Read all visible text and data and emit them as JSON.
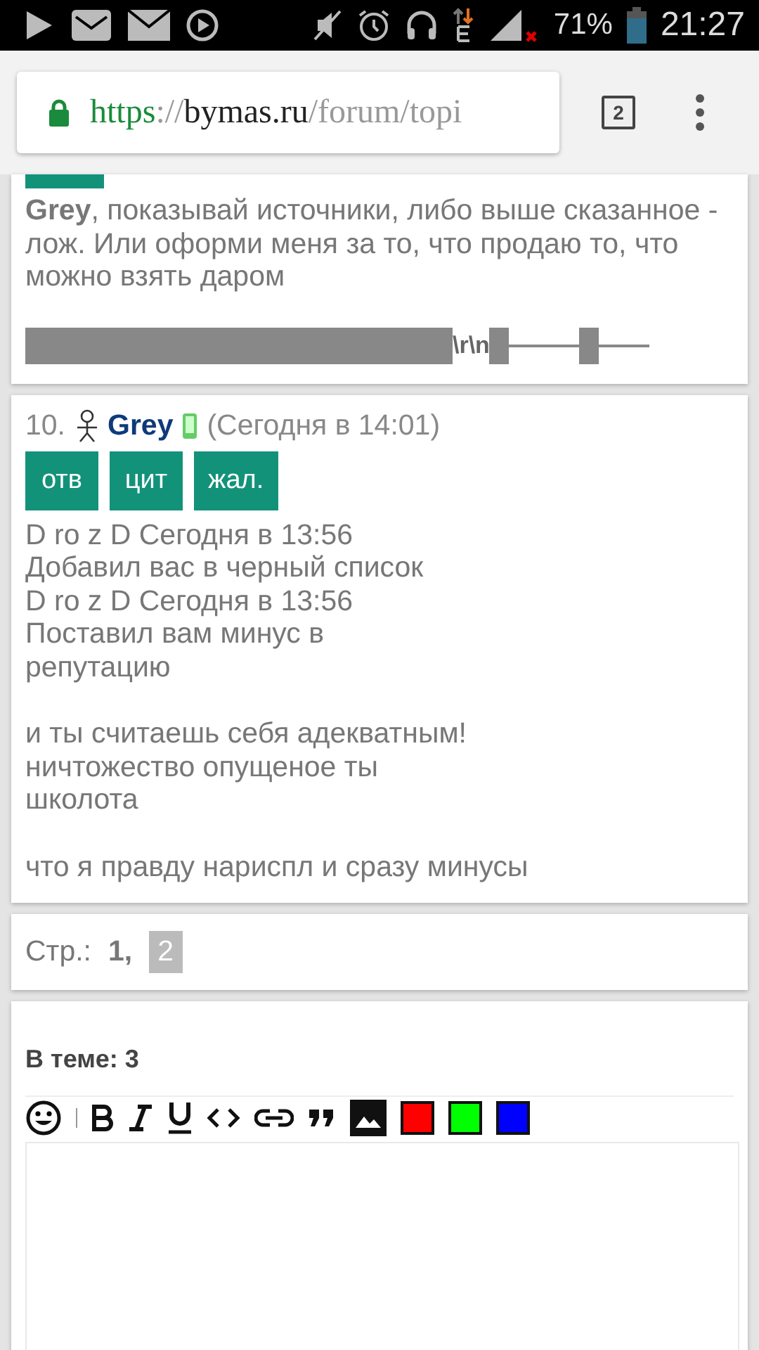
{
  "status_bar": {
    "battery": "71%",
    "time": "21:27"
  },
  "browser": {
    "url_scheme": "https",
    "url_sep": "://",
    "url_host": "bymas.ru",
    "url_path": "/forum/topi",
    "tab_count": "2"
  },
  "posts": [
    {
      "cut_top": true,
      "paragraphs": [
        [
          "**Grey**, показывай источники, либо выше сказанное - лож. Или оформи меня за то, что продаю то, что можно взять даром"
        ]
      ],
      "garbled": "\\r\\n"
    },
    {
      "cut_top": false,
      "number": "10.",
      "author": "Grey",
      "time": "(Сегодня в 14:01)",
      "actions": [
        "отв",
        "цит",
        "жал."
      ],
      "paragraphs": [
        [
          "D ro z D Сегодня в 13:56",
          "Добавил вас в черный список",
          "D ro z D Сегодня в 13:56",
          "Поставил вам минус в",
          "репутацию"
        ],
        [
          "и ты считаешь себя адекватным!",
          "ничтожество опущеное ты",
          "школота"
        ],
        [
          "что я правду нариспл и сразу минусы"
        ]
      ]
    }
  ],
  "pagination": {
    "label": "Стр.:",
    "pages": [
      {
        "label": "1,",
        "selected": false
      },
      {
        "label": "2",
        "selected": true
      }
    ]
  },
  "reply": {
    "topic_count": "В теме: 3",
    "colors": [
      {
        "color": "#ff0000"
      },
      {
        "color": "#00ff00"
      },
      {
        "color": "#0000ff"
      }
    ]
  }
}
